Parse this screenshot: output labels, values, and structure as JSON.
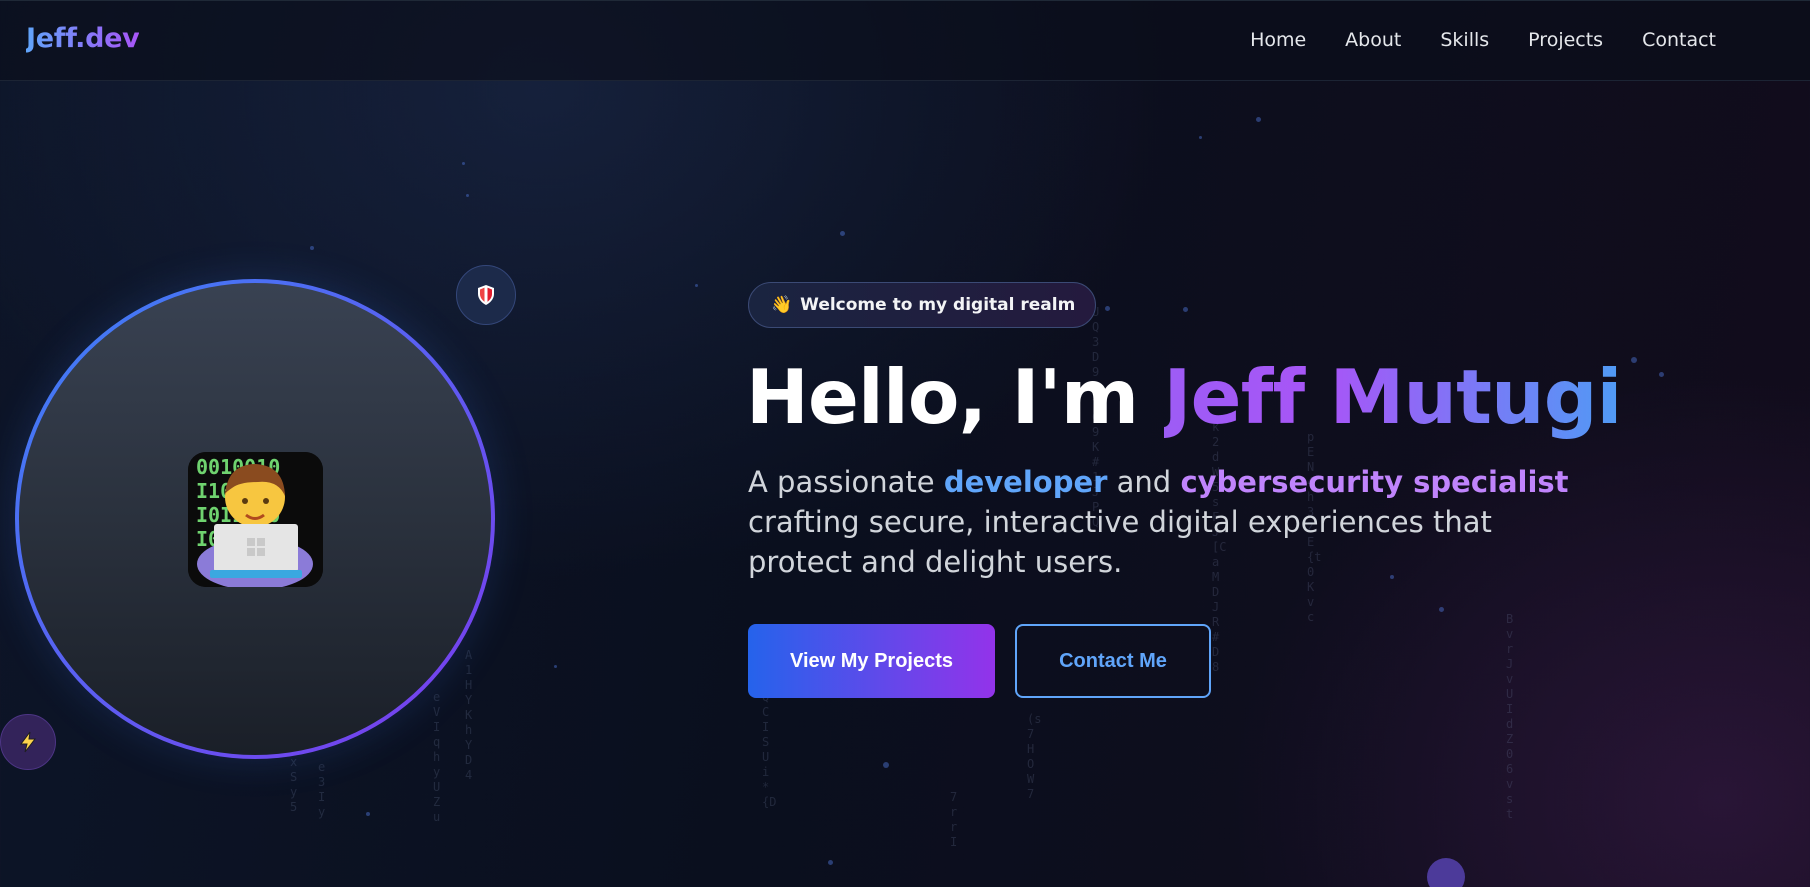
{
  "navbar": {
    "logo": "Jeff.dev",
    "links": [
      "Home",
      "About",
      "Skills",
      "Projects",
      "Contact"
    ]
  },
  "hero": {
    "badge": {
      "icon": "waving-hand-icon",
      "text": "Welcome to my digital realm"
    },
    "title": {
      "greeting": "Hello, I'm ",
      "name": "Jeff Mutugi"
    },
    "subtitle": {
      "part1": "A passionate ",
      "highlight1": "developer",
      "part2": " and ",
      "highlight2": "cybersecurity specialist",
      "part3": " crafting secure, interactive digital experiences that protect and delight users."
    },
    "buttons": {
      "primary": "View My Projects",
      "secondary": "Contact Me"
    }
  },
  "avatar": {
    "icon": "technologist-icon",
    "floating_icons": [
      "shield-icon",
      "lightning-icon"
    ]
  },
  "colors": {
    "background": "#0a0f1e",
    "accent_blue": "#60a5fa",
    "accent_purple": "#a855f7",
    "primary_gradient_start": "#2563eb",
    "primary_gradient_end": "#9333ea"
  }
}
